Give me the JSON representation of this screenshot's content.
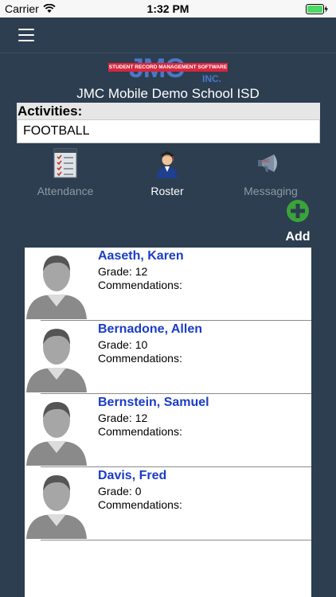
{
  "status": {
    "carrier": "Carrier",
    "time": "1:32 PM"
  },
  "logo": {
    "brand": "JMC",
    "tagline": "STUDENT RECORD MANAGEMENT SOFTWARE",
    "suffix": "INC."
  },
  "school_name": "JMC Mobile Demo School ISD",
  "activities": {
    "label": "Activities:",
    "value": "FOOTBALL"
  },
  "tabs": [
    {
      "label": "Attendance",
      "icon": "checklist-icon"
    },
    {
      "label": "Roster",
      "icon": "student-icon"
    },
    {
      "label": "Messaging",
      "icon": "megaphone-icon"
    }
  ],
  "add": {
    "label": "Add"
  },
  "grade_label": "Grade:",
  "commendations_label": "Commendations:",
  "students": [
    {
      "name": "Aaseth, Karen",
      "grade": "12"
    },
    {
      "name": "Bernadone, Allen",
      "grade": "10"
    },
    {
      "name": "Bernstein, Samuel",
      "grade": "12"
    },
    {
      "name": "Davis, Fred",
      "grade": "0"
    }
  ],
  "colors": {
    "background": "#2c3e50",
    "name_link": "#1a3cc8",
    "add_green": "#3aa33a"
  }
}
